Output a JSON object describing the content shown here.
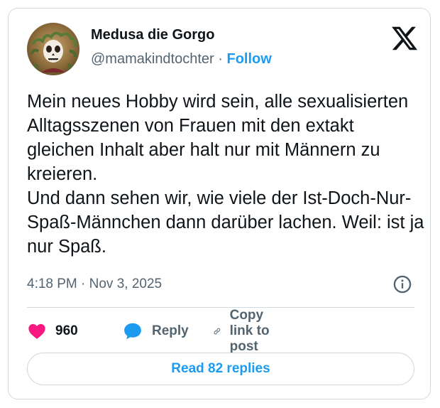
{
  "author": {
    "display_name": "Medusa die Gorgo",
    "handle": "@mamakindtochter",
    "separator": "·",
    "follow_label": "Follow"
  },
  "logo_icon": "x-logo-icon",
  "tweet": {
    "text": "Mein neues Hobby wird sein, alle sexualisierten Alltagsszenen von Frauen mit den extakt gleichen Inhalt aber halt nur mit Männern zu kreieren.\nUnd dann sehen wir, wie viele der Ist-Doch-Nur-Spaß-Männchen dann darüber lachen. Weil: ist ja nur Spaß.",
    "timestamp": "4:18 PM · Nov 3, 2025"
  },
  "actions": {
    "like_count": "960",
    "like_icon": "heart-icon",
    "reply_label": "Reply",
    "reply_icon": "speech-bubble-icon",
    "copy_label": "Copy link to post",
    "copy_icon": "link-icon",
    "info_icon": "info-icon"
  },
  "read_replies_label": "Read 82 replies",
  "colors": {
    "accent": "#1d9bf0",
    "like": "#f91880",
    "text": "#0f1419",
    "muted": "#536471",
    "border": "#cfd9de"
  }
}
